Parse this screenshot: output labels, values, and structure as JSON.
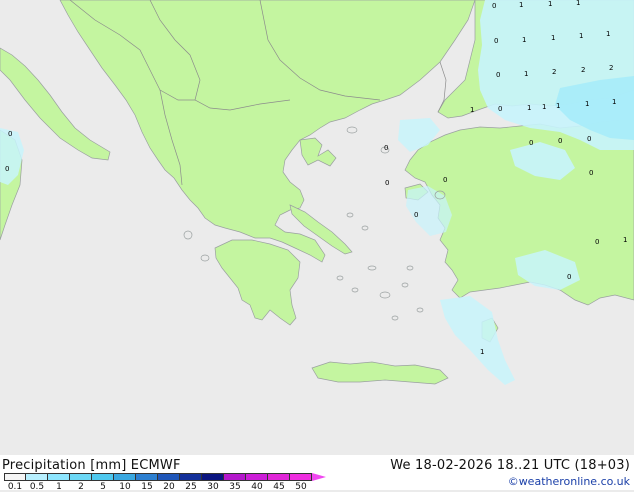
{
  "header": {
    "title_left": "Precipitation [mm]  ECMWF",
    "title_right": "We 18-02-2026 18..21 UTC (18+03)",
    "credit": "©weatheronline.co.uk"
  },
  "legend": {
    "labels": [
      "0.1",
      "0.5",
      "1",
      "2",
      "5",
      "10",
      "15",
      "20",
      "25",
      "30",
      "35",
      "40",
      "45",
      "50"
    ],
    "colors": [
      "#f5f5f5",
      "#b8f0ff",
      "#8ee6ff",
      "#6cd8f6",
      "#4ec8ee",
      "#3aa8e0",
      "#2c7fd0",
      "#1f56b8",
      "#14309a",
      "#0b1580",
      "#b418cc",
      "#cc1ed8",
      "#e026d8",
      "#ef2ee0",
      "#f048f0"
    ]
  },
  "map": {
    "colors": {
      "sea": "#ebebeb",
      "land": "#c4f5a0",
      "coast": "#9aa0a0",
      "border": "#8c8c8c",
      "precip_light": "#c8f4fc",
      "precip_mid": "#a6ecfa",
      "precip_heavy": "#7fdcf6"
    },
    "values": [
      "0",
      "1",
      "1",
      "1",
      "0",
      "1",
      "1",
      "1",
      "1",
      "0",
      "1",
      "2",
      "2",
      "2",
      "0",
      "1",
      "1",
      "1",
      "1",
      "1",
      "1",
      "0",
      "0",
      "0",
      "0",
      "0",
      "0",
      "0",
      "0",
      "0",
      "1",
      "0",
      "1",
      "0",
      "0"
    ]
  }
}
